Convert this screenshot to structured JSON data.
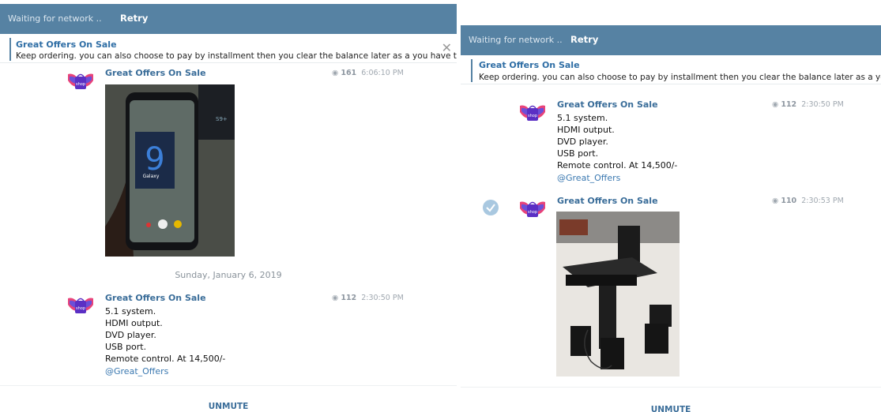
{
  "network": {
    "status": "Waiting for network ..",
    "retry": "Retry"
  },
  "pinned": {
    "title": "Great Offers On Sale",
    "text": "Keep ordering. you can also choose to pay by installment then you clear the balance later as a you have th..."
  },
  "left": {
    "photo_post": {
      "sender": "Great Offers On Sale",
      "views": "161",
      "time": "6:06:10 PM"
    },
    "date_separator": "Sunday, January 6, 2019",
    "text_post": {
      "sender": "Great Offers On Sale",
      "views": "112",
      "time": "2:30:50 PM",
      "lines": [
        "5.1 system.",
        "HDMI output.",
        "DVD player.",
        "USB port.",
        "Remote control. At 14,500/-"
      ],
      "link": "@Great_Offers"
    },
    "unmute": "UNMUTE"
  },
  "right": {
    "text_post": {
      "sender": "Great Offers On Sale",
      "views": "112",
      "time": "2:30:50 PM",
      "lines": [
        "5.1 system.",
        "HDMI output.",
        "DVD player.",
        "USB port.",
        "Remote control. At 14,500/-"
      ],
      "link": "@Great_Offers"
    },
    "photo_post": {
      "sender": "Great Offers On Sale",
      "views": "110",
      "time": "2:30:53 PM"
    },
    "unmute": "UNMUTE"
  },
  "avatar_text": "shop",
  "colors": {
    "header": "#5682a3",
    "accent": "#3a6d99",
    "link": "#3a78b0"
  }
}
